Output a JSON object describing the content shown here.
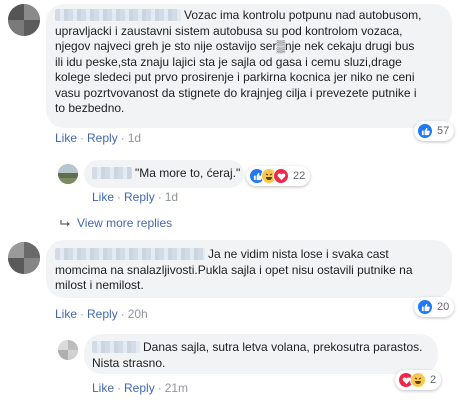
{
  "comment1": {
    "lines": [
      "Vozac ima kontrolu potpunu nad autobusom,",
      "upravljacki i zaustavni sistem autobusa su pod kontrolom vozaca,",
      "njegov najveci greh je sto nije ostavijo ser▒nje nek cekaju drugi bus",
      "ili idu peske,sta znaju lajici sta je sajla od gasa i cemu sluzi,drage",
      "kolege sledeci put prvo prosirenje i parkirna kocnica jer niko ne ceni",
      "vasu pozrtvovanost da stignete do krajnjeg cilja i prevezete putnike i",
      "to bezbedno."
    ],
    "like": "Like",
    "reply": "Reply",
    "time": "1d",
    "reaction_count": "57"
  },
  "reply1": {
    "text": "\"Ma more to, ćeraj.\"",
    "like": "Like",
    "reply": "Reply",
    "time": "1d",
    "reaction_count": "22"
  },
  "view_more": {
    "label": "View more replies"
  },
  "comment2": {
    "lines": [
      "Ja ne vidim nista lose i svaka cast",
      "momcima na snalazljivosti.Pukla sajla i opet nisu ostavili putnike na",
      "milost i nemilost."
    ],
    "like": "Like",
    "reply": "Reply",
    "time": "20h",
    "reaction_count": "20"
  },
  "reply2": {
    "lines": [
      "Danas sajla, sutra letva volana, prekosutra parastos.",
      "Nista strasno."
    ],
    "like": "Like",
    "reply": "Reply",
    "time": "21m",
    "reaction_count": "2"
  },
  "colors": {
    "link": "#4267b2",
    "bubble": "#f2f3f5",
    "meta": "#90949c",
    "like_reaction": "#2078f4",
    "haha_reaction": "#f7c84a",
    "love_reaction": "#f0284a"
  },
  "icons": [
    "like-reaction-icon",
    "haha-reaction-icon",
    "love-reaction-icon",
    "reply-arrow-icon"
  ]
}
